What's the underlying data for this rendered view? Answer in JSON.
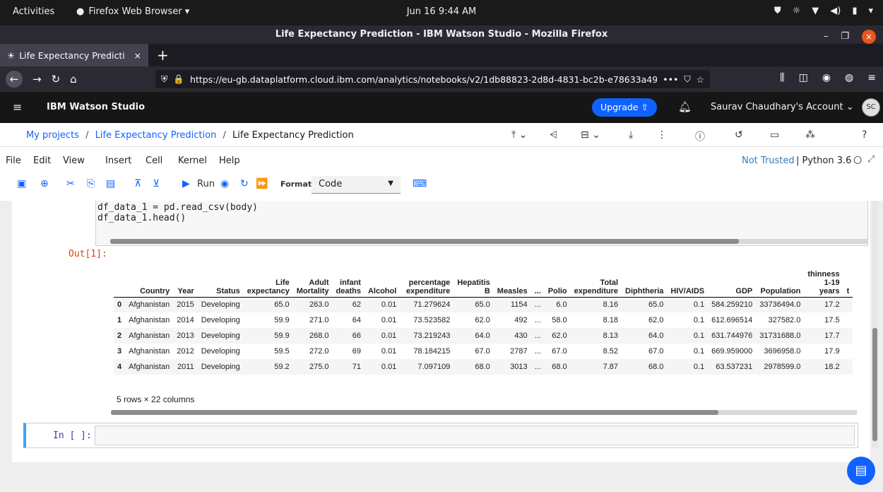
{
  "gnome": {
    "activities": "Activities",
    "app_name": "Firefox Web Browser ▾",
    "clock": "Jun 16  9:44 AM"
  },
  "window": {
    "title": "Life Expectancy Prediction - IBM Watson Studio - Mozilla Firefox"
  },
  "tab": {
    "title": "Life Expectancy Predicti",
    "close": "×",
    "new_tab": "+"
  },
  "urlbar": {
    "url": "https://eu-gb.dataplatform.cloud.ibm.com/analytics/notebooks/v2/1db88823-2d8d-4831-bc2b-e78633a49",
    "more": "•••"
  },
  "header": {
    "brand": "IBM Watson Studio",
    "upgrade_label": "Upgrade ⇧",
    "account": "Saurav Chaudhary's Account ⌄",
    "avatar": "SC"
  },
  "breadcrumb": {
    "items": [
      "My projects",
      "Life Expectancy Prediction"
    ],
    "separator": "/",
    "current": "Life Expectancy Prediction"
  },
  "menu": {
    "items": [
      "File",
      "Edit",
      "View",
      "Insert",
      "Cell",
      "Kernel",
      "Help"
    ],
    "trust": "Not Trusted",
    "kernel": "| Python 3.6"
  },
  "toolbar": {
    "run_label": "Run",
    "format_label": "Format",
    "format_value": "Code"
  },
  "cell1": {
    "code_line1": "df_data_1 = pd.read_csv(body)",
    "code_line2": "df_data_1.head()",
    "out_prompt": "Out[1]:"
  },
  "dataframe": {
    "headers": [
      "",
      "Country",
      "Year",
      "Status",
      "Life expectancy",
      "Adult Mortality",
      "infant deaths",
      "Alcohol",
      "percentage expenditure",
      "Hepatitis B",
      "Measles",
      "...",
      "Polio",
      "Total expenditure",
      "Diphtheria",
      "HIV/AIDS",
      "GDP",
      "Population",
      "thinness 1-19 years",
      "t"
    ],
    "rows": [
      [
        "0",
        "Afghanistan",
        "2015",
        "Developing",
        "65.0",
        "263.0",
        "62",
        "0.01",
        "71.279624",
        "65.0",
        "1154",
        "...",
        "6.0",
        "8.16",
        "65.0",
        "0.1",
        "584.259210",
        "33736494.0",
        "17.2",
        ""
      ],
      [
        "1",
        "Afghanistan",
        "2014",
        "Developing",
        "59.9",
        "271.0",
        "64",
        "0.01",
        "73.523582",
        "62.0",
        "492",
        "...",
        "58.0",
        "8.18",
        "62.0",
        "0.1",
        "612.696514",
        "327582.0",
        "17.5",
        ""
      ],
      [
        "2",
        "Afghanistan",
        "2013",
        "Developing",
        "59.9",
        "268.0",
        "66",
        "0.01",
        "73.219243",
        "64.0",
        "430",
        "...",
        "62.0",
        "8.13",
        "64.0",
        "0.1",
        "631.744976",
        "31731688.0",
        "17.7",
        ""
      ],
      [
        "3",
        "Afghanistan",
        "2012",
        "Developing",
        "59.5",
        "272.0",
        "69",
        "0.01",
        "78.184215",
        "67.0",
        "2787",
        "...",
        "67.0",
        "8.52",
        "67.0",
        "0.1",
        "669.959000",
        "3696958.0",
        "17.9",
        ""
      ],
      [
        "4",
        "Afghanistan",
        "2011",
        "Developing",
        "59.2",
        "275.0",
        "71",
        "0.01",
        "7.097109",
        "68.0",
        "3013",
        "...",
        "68.0",
        "7.87",
        "68.0",
        "0.1",
        "63.537231",
        "2978599.0",
        "18.2",
        ""
      ]
    ],
    "row_count": "5 rows × 22 columns"
  },
  "cell2": {
    "in_prompt": "In [ ]:"
  }
}
